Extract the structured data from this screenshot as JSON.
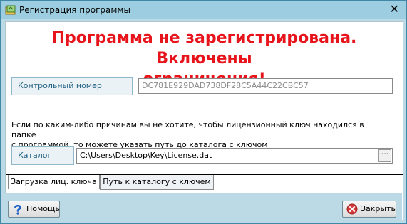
{
  "window": {
    "title": "Регистрация программы",
    "close_glyph": "✕"
  },
  "warning": {
    "line1": "Программа  не зарегистрирована. Включены",
    "line2": "ограничения!"
  },
  "control_number": {
    "label": "Контрольный номер",
    "value": "DC781E929DAD738DF28C5A44C22CBC57"
  },
  "hint": {
    "line1": "Если по каким-либо причинам вы не хотите, чтобы лицензионный ключ находился в папке",
    "line2": "с программой, то можете указать путь до каталога с ключом"
  },
  "catalog": {
    "label": "Каталог",
    "value": "C:\\Users\\Desktop\\Key\\License.dat",
    "browse_label": "···"
  },
  "tabs": [
    {
      "label": "Загрузка лиц. ключа"
    },
    {
      "label": "Путь к каталогу с ключем"
    }
  ],
  "buttons": {
    "help": "Помощь",
    "close": "Закрыть"
  },
  "icons": {
    "app": "app-icon",
    "help": "question-icon",
    "close": "red-x-icon"
  },
  "colors": {
    "warning": "#e8141b",
    "titlebar": "#9ccde0",
    "frame": "#bcd9e6"
  }
}
